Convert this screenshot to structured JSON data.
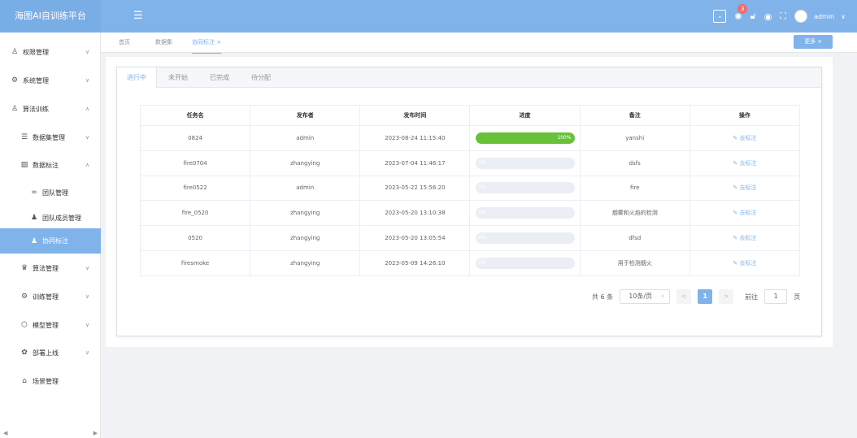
{
  "header": {
    "app_title": "海图AI自训练平台",
    "badge_count": "3",
    "user_name": "admin"
  },
  "sidebar": {
    "items": [
      {
        "label": "权限管理",
        "icon": "user-icon"
      },
      {
        "label": "系统管理",
        "icon": "settings-icon"
      },
      {
        "label": "算法训练",
        "icon": "user-icon"
      },
      {
        "label": "数据集管理",
        "icon": "list-icon"
      },
      {
        "label": "数据标注",
        "icon": "image-icon"
      },
      {
        "label": "团队管理",
        "icon": "link-icon"
      },
      {
        "label": "团队成员管理",
        "icon": "team-icon"
      },
      {
        "label": "协同标注",
        "icon": "team-icon"
      },
      {
        "label": "算法管理",
        "icon": "graduation-icon"
      },
      {
        "label": "训练管理",
        "icon": "gear-icon"
      },
      {
        "label": "模型管理",
        "icon": "cube-icon"
      },
      {
        "label": "部署上线",
        "icon": "flower-icon"
      },
      {
        "label": "场景管理",
        "icon": "shop-icon"
      }
    ]
  },
  "tags": {
    "items": [
      "首页",
      "数据集",
      "协同标注 ×"
    ],
    "more_label": "更多 ∨"
  },
  "tabs": [
    "进行中",
    "未开始",
    "已完成",
    "待分配"
  ],
  "table": {
    "headers": [
      "任务名",
      "发布者",
      "发布时间",
      "进度",
      "备注",
      "操作"
    ],
    "rows": [
      {
        "name": "0824",
        "publisher": "admin",
        "time": "2023-08-24 11:15:40",
        "progress": 100,
        "progress_label": "100%",
        "note": "yanshi",
        "action": "去标注"
      },
      {
        "name": "fire0704",
        "publisher": "zhangying",
        "time": "2023-07-04 11:46:17",
        "progress": 0,
        "progress_label": "0%",
        "note": "dsfs",
        "action": "去标注"
      },
      {
        "name": "fire0522",
        "publisher": "admin",
        "time": "2023-05-22 15:56:20",
        "progress": 0,
        "progress_label": "0%",
        "note": "fire",
        "action": "去标注"
      },
      {
        "name": "fire_0520",
        "publisher": "zhangying",
        "time": "2023-05-20 13:10:38",
        "progress": 0,
        "progress_label": "0%",
        "note": "烟雾和火焰的检测",
        "action": "去标注"
      },
      {
        "name": "0520",
        "publisher": "zhangying",
        "time": "2023-05-20 13:05:54",
        "progress": 0,
        "progress_label": "0%",
        "note": "dfsd",
        "action": "去标注"
      },
      {
        "name": "firesmoke",
        "publisher": "zhangying",
        "time": "2023-05-09 14:26:10",
        "progress": 0,
        "progress_label": "0%",
        "note": "用于检测烟火",
        "action": "去标注"
      }
    ]
  },
  "pagination": {
    "total": "共 6 条",
    "page_size": "10条/页",
    "current": "1",
    "goto_label": "前往",
    "goto_value": "1",
    "page_suffix": "页"
  },
  "colors": {
    "accent": "#7fb3ea",
    "success": "#67c23a"
  }
}
